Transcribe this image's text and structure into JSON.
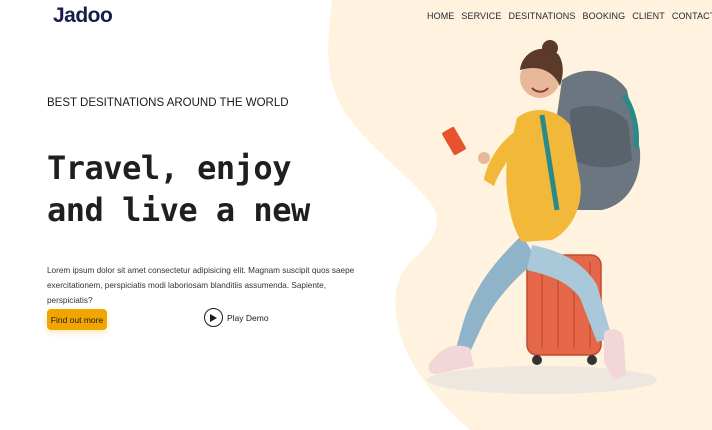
{
  "brand": {
    "logo": "Jadoo"
  },
  "nav": {
    "items": [
      "HOME",
      "SERVICE",
      "DESITNATIONS",
      "BOOKING",
      "CLIENT",
      "CONTACT"
    ]
  },
  "hero": {
    "subtitle": "BEST DESITNATIONS AROUND THE WORLD",
    "headline_line1": "Travel, enjoy",
    "headline_line2": "and live a new",
    "description": "Lorem ipsum dolor sit amet consectetur adipisicing elit. Magnam suscipit quos saepe exercitationem, perspiciatis modi laboriosam blanditiis assumenda. Sapiente, perspiciatis?",
    "cta_label": "Find out more",
    "demo_label": "Play Demo"
  },
  "icons": {
    "play": "play-icon",
    "traveler": "traveler-illustration"
  },
  "colors": {
    "accent": "#f1a501",
    "blob": "#fff3e0",
    "text": "#1a1a1a"
  }
}
